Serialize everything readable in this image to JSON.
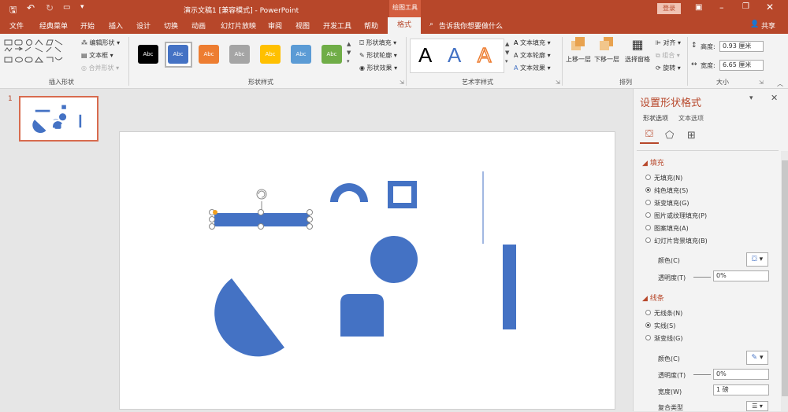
{
  "titlebar": {
    "title": "演示文稿1 [兼容模式] - PowerPoint",
    "context_tab": "绘图工具",
    "login": "登录",
    "save_icon": "save-icon",
    "undo_icon": "undo-icon",
    "redo_icon": "redo-icon",
    "present_icon": "present-icon",
    "customize_icon": "customize-icon"
  },
  "tabs": [
    "文件",
    "经典菜单",
    "开始",
    "插入",
    "设计",
    "切换",
    "动画",
    "幻灯片放映",
    "审阅",
    "视图",
    "开发工具",
    "帮助",
    "格式"
  ],
  "tell_me": "告诉我你想要做什么",
  "share": "共享",
  "ribbon": {
    "insert_shapes": {
      "label": "插入形状",
      "edit_shape": "编辑形状",
      "text_box": "文本框",
      "merge_shapes": "合并形状"
    },
    "shape_styles": {
      "label": "形状样式",
      "swatch_text": "Abc",
      "fill": "形状填充",
      "outline": "形状轮廓",
      "effects": "形状效果"
    },
    "wordart": {
      "label": "艺术字样式",
      "letter": "A",
      "text_fill": "文本填充",
      "text_outline": "文本轮廓",
      "text_effects": "文本效果"
    },
    "arrange": {
      "label": "排列",
      "bring_forward": "上移一层",
      "send_backward": "下移一层",
      "selection_pane": "选择窗格",
      "align": "对齐",
      "group": "组合",
      "rotate": "旋转"
    },
    "size": {
      "label": "大小",
      "height_label": "高度:",
      "height_value": "0.93 厘米",
      "width_label": "宽度:",
      "width_value": "6.65 厘米"
    }
  },
  "thumb_number": "1",
  "format_pane": {
    "title": "设置形状格式",
    "tab_shape": "形状选项",
    "tab_text": "文本选项",
    "fill_header": "填充",
    "fill_options": [
      "无填充(N)",
      "纯色填充(S)",
      "渐变填充(G)",
      "图片或纹理填充(P)",
      "图案填充(A)",
      "幻灯片背景填充(B)"
    ],
    "fill_selected": 1,
    "color_label": "颜色(C)",
    "transparency_label": "透明度(T)",
    "transparency_value": "0%",
    "line_header": "线条",
    "line_options": [
      "无线条(N)",
      "实线(S)",
      "渐变线(G)"
    ],
    "line_selected": 1,
    "line_color_label": "颜色(C)",
    "line_transparency_label": "透明度(T)",
    "line_transparency_value": "0%",
    "width_label": "宽度(W)",
    "width_value": "1 磅",
    "compound_label": "复合类型"
  },
  "colors": {
    "brand": "#b7472a",
    "shape": "#4472c4"
  }
}
